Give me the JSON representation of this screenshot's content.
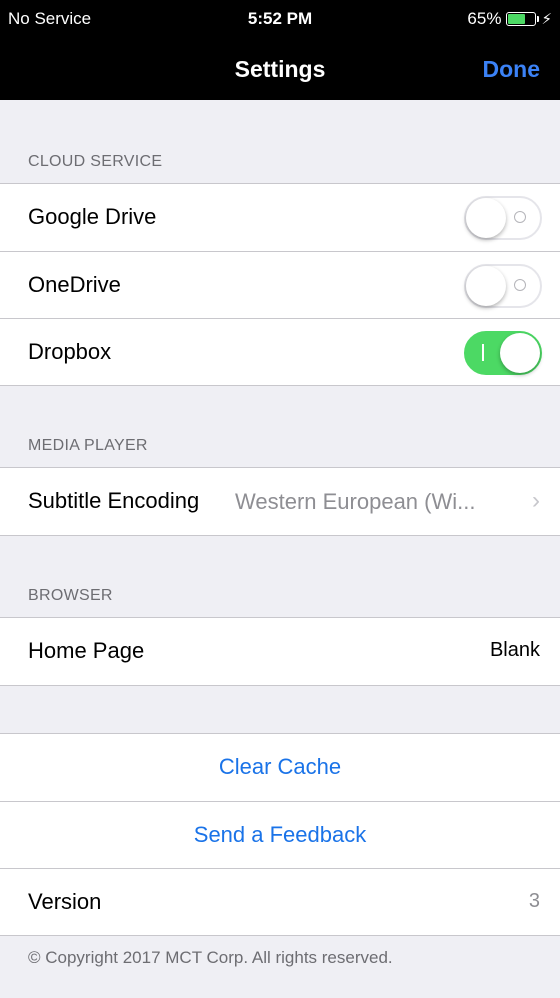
{
  "status_bar": {
    "carrier": "No Service",
    "time": "5:52 PM",
    "battery_percent": "65%",
    "battery_level": 0.65
  },
  "nav": {
    "title": "Settings",
    "done_label": "Done"
  },
  "cloud_service": {
    "header": "CLOUD SERVICE",
    "items": [
      {
        "label": "Google Drive",
        "enabled": false
      },
      {
        "label": "OneDrive",
        "enabled": false
      },
      {
        "label": "Dropbox",
        "enabled": true
      }
    ]
  },
  "media_player": {
    "header": "MEDIA PLAYER",
    "subtitle_encoding_label": "Subtitle Encoding",
    "subtitle_encoding_value": "Western European (Wi..."
  },
  "browser": {
    "header": "BROWSER",
    "home_page_label": "Home Page",
    "home_page_value": "Blank"
  },
  "actions": {
    "clear_cache": "Clear Cache",
    "send_feedback": "Send a Feedback",
    "version_label": "Version",
    "version_value": "3"
  },
  "footer": {
    "copyright": "© Copyright 2017 MCT Corp. All rights reserved."
  },
  "colors": {
    "accent": "#1a73e8",
    "toggle_on": "#4cd964",
    "background": "#efeff4"
  }
}
